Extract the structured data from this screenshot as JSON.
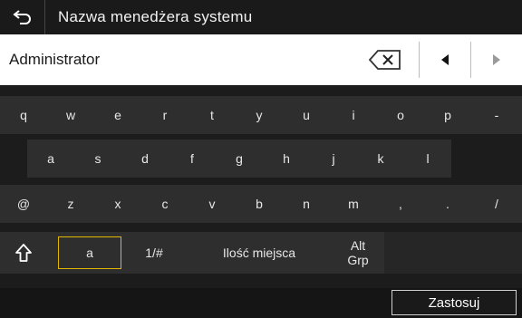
{
  "header": {
    "title": "Nazwa menedżera systemu",
    "back_icon": "back-arrow-icon"
  },
  "input": {
    "value": "Administrator",
    "backspace_icon": "backspace-icon",
    "left_icon": "caret-left-icon",
    "right_icon": "caret-right-icon"
  },
  "keyboard": {
    "row1": [
      "q",
      "w",
      "e",
      "r",
      "t",
      "y",
      "u",
      "i",
      "o",
      "p",
      "-"
    ],
    "row2": [
      "a",
      "s",
      "d",
      "f",
      "g",
      "h",
      "j",
      "k",
      "l"
    ],
    "row3": [
      "@",
      "z",
      "x",
      "c",
      "v",
      "b",
      "n",
      "m",
      ",",
      ".",
      "/"
    ],
    "row4": {
      "shift_icon": "shift-icon",
      "mode_a": "a",
      "symbols": "1/#",
      "space": "Ilość miejsca",
      "alt_line1": "Alt",
      "alt_line2": "Grp"
    }
  },
  "footer": {
    "apply": "Zastosuj"
  }
}
